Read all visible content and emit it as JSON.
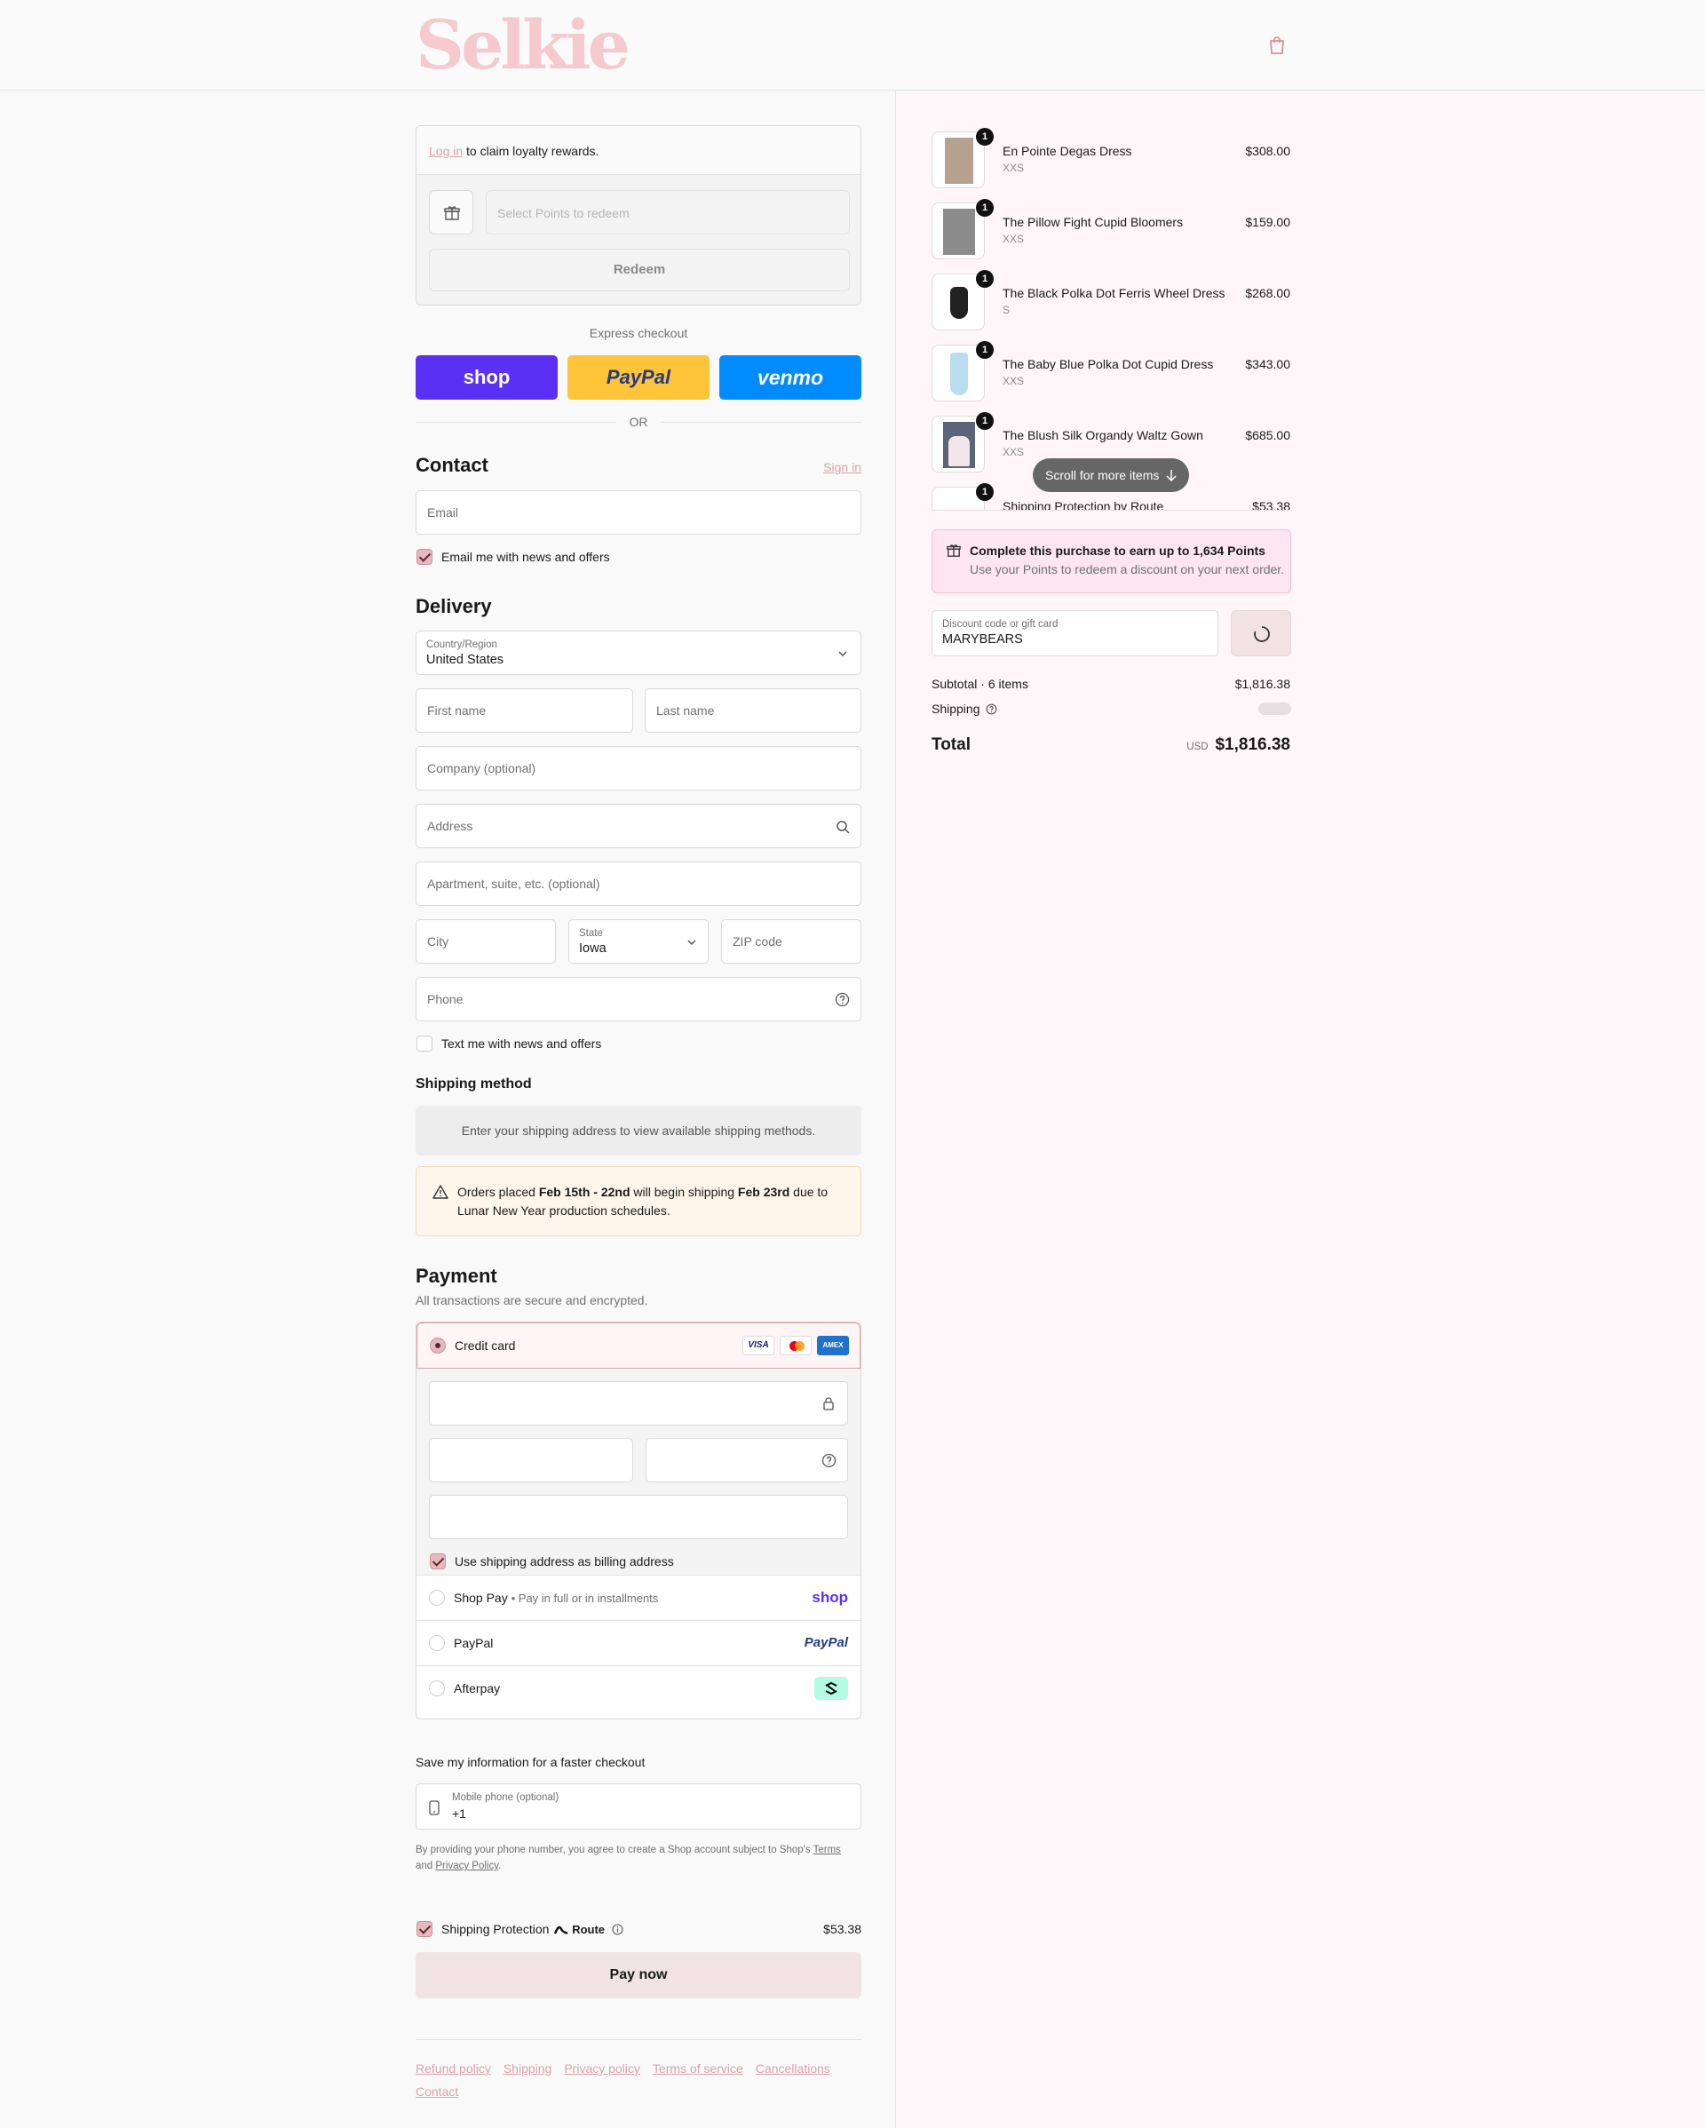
{
  "brand": {
    "name": "Selkie"
  },
  "loyalty": {
    "login_link": "Log in",
    "login_text": "to claim loyalty rewards.",
    "select_placeholder": "Select Points to redeem",
    "redeem_label": "Redeem"
  },
  "express": {
    "title": "Express checkout",
    "shop_label": "shop",
    "paypal_label": "PayPal",
    "venmo_label": "venmo",
    "or_label": "OR"
  },
  "contact": {
    "title": "Contact",
    "sign_in": "Sign in",
    "email_placeholder": "Email",
    "news_label": "Email me with news and offers"
  },
  "delivery": {
    "title": "Delivery",
    "country_label": "Country/Region",
    "country_value": "United States",
    "first_name": "First name",
    "last_name": "Last name",
    "company": "Company (optional)",
    "address": "Address",
    "apartment": "Apartment, suite, etc. (optional)",
    "city": "City",
    "state_label": "State",
    "state_value": "Iowa",
    "zip": "ZIP code",
    "phone": "Phone",
    "text_label": "Text me with news and offers"
  },
  "shipping_method": {
    "title": "Shipping method",
    "message": "Enter your shipping address to view available shipping methods."
  },
  "notice": {
    "part1": "Orders placed ",
    "bold1": "Feb 15th - 22nd",
    "part2": " will begin shipping ",
    "bold2": "Feb 23rd",
    "part3": " due to",
    "line2": "Lunar New Year production schedules."
  },
  "payment": {
    "title": "Payment",
    "subtitle": "All transactions are secure and encrypted.",
    "credit_card": "Credit card",
    "visa": "VISA",
    "amex": "AMEX",
    "billing_label": "Use shipping address as billing address",
    "shop_pay": "Shop Pay",
    "shop_pay_sub": "• Pay in full or in installments",
    "shop_logo": "shop",
    "paypal": "PayPal",
    "paypal_logo": "PayPal",
    "afterpay": "Afterpay"
  },
  "save_info": {
    "title": "Save my information for a faster checkout",
    "mobile_label": "Mobile phone (optional)",
    "mobile_value": "+1",
    "legal1": "By providing your phone number, you agree to create a Shop account subject to Shop's ",
    "terms": "Terms",
    "legal2": "and ",
    "privacy": "Privacy Policy",
    "legal3": "."
  },
  "protection": {
    "label": "Shipping Protection",
    "route": "Route",
    "price": "$53.38"
  },
  "pay_now": "Pay now",
  "footer": {
    "links": [
      "Refund policy",
      "Shipping",
      "Privacy policy",
      "Terms of service",
      "Cancellations"
    ],
    "contact": "Contact"
  },
  "cart": {
    "items": [
      {
        "name": "En Pointe Degas Dress",
        "variant": "XXS",
        "price": "$308.00",
        "qty": "1"
      },
      {
        "name": "The Pillow Fight Cupid Bloomers",
        "variant": "XXS",
        "price": "$159.00",
        "qty": "1"
      },
      {
        "name": "The Black Polka Dot Ferris Wheel Dress",
        "variant": "S",
        "price": "$268.00",
        "qty": "1"
      },
      {
        "name": "The Baby Blue Polka Dot Cupid Dress",
        "variant": "XXS",
        "price": "$343.00",
        "qty": "1"
      },
      {
        "name": "The Blush Silk Organdy Waltz Gown",
        "variant": "XXS",
        "price": "$685.00",
        "qty": "1"
      },
      {
        "name": "Shipping Protection by Route",
        "variant": "",
        "price": "$53.38",
        "qty": "1"
      }
    ],
    "scroll_hint": "Scroll for more items"
  },
  "points": {
    "title": "Complete this purchase to earn up to 1,634 Points",
    "subtitle": "Use your Points to redeem a discount on your next order."
  },
  "discount": {
    "label": "Discount code or gift card",
    "value": "MARYBEARS"
  },
  "summary": {
    "subtotal_label": "Subtotal · 6 items",
    "subtotal_value": "$1,816.38",
    "shipping_label": "Shipping",
    "total_label": "Total",
    "currency": "USD",
    "total_value": "$1,816.38"
  }
}
